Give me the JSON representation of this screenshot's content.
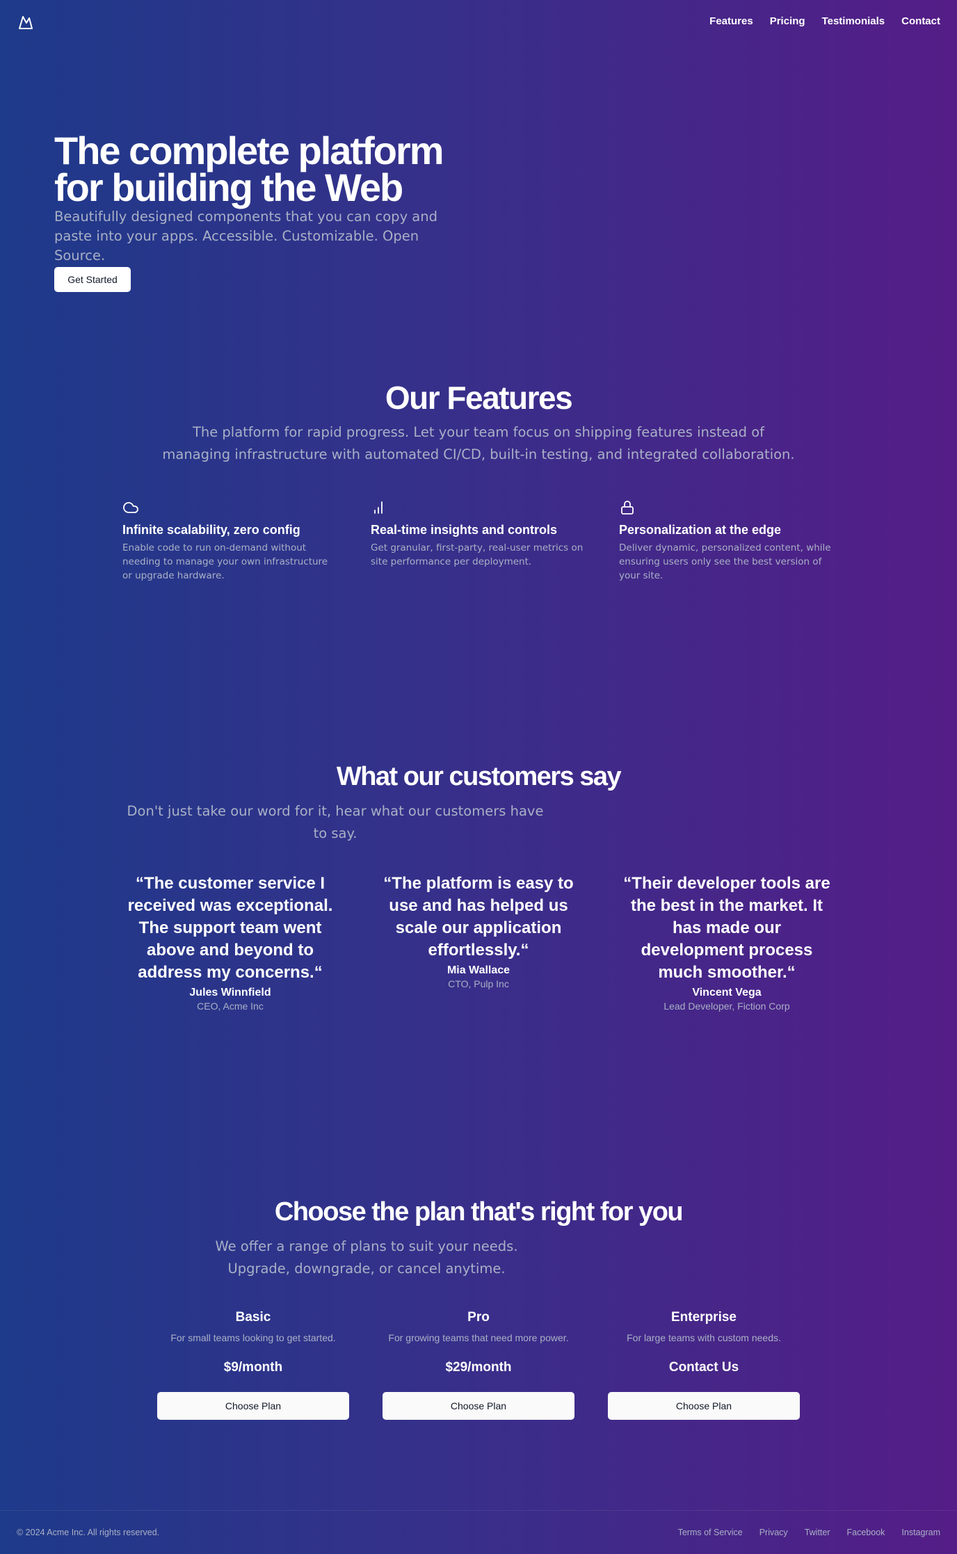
{
  "nav": {
    "logo_icon": "mountain-icon",
    "links": [
      "Features",
      "Pricing",
      "Testimonials",
      "Contact"
    ]
  },
  "hero": {
    "title_line1": "The complete platform",
    "title_line2": "for building the Web",
    "subtitle": "Beautifully designed components that you can copy and paste into your apps. Accessible. Customizable. Open Source.",
    "cta": "Get Started"
  },
  "features": {
    "title": "Our Features",
    "subtitle": "The platform for rapid progress. Let your team focus on shipping features instead of managing infrastructure with automated CI/CD, built-in testing, and integrated collaboration.",
    "items": [
      {
        "icon": "cloud-icon",
        "title": "Infinite scalability, zero config",
        "desc": "Enable code to run on-demand without needing to manage your own infrastructure or upgrade hardware."
      },
      {
        "icon": "bar-chart-icon",
        "title": "Real-time insights and controls",
        "desc": "Get granular, first-party, real-user metrics on site performance per deployment."
      },
      {
        "icon": "lock-icon",
        "title": "Personalization at the edge",
        "desc": "Deliver dynamic, personalized content, while ensuring users only see the best version of your site."
      }
    ]
  },
  "testimonials": {
    "title": "What our customers say",
    "subtitle": "Don't just take our word for it, hear what our customers have to say.",
    "items": [
      {
        "quote": "“The customer service I received was exceptional. The support team went above and beyond to address my concerns.“",
        "author": "Jules Winnfield",
        "role": "CEO, Acme Inc"
      },
      {
        "quote": "“The platform is easy to use and has helped us scale our application effortlessly.“",
        "author": "Mia Wallace",
        "role": "CTO, Pulp Inc"
      },
      {
        "quote": "“Their developer tools are the best in the market. It has made our development process much smoother.“",
        "author": "Vincent Vega",
        "role": "Lead Developer, Fiction Corp"
      }
    ]
  },
  "pricing": {
    "title": "Choose the plan that's right for you",
    "subtitle": "We offer a range of plans to suit your needs. Upgrade, downgrade, or cancel anytime.",
    "plans": [
      {
        "name": "Basic",
        "desc": "For small teams looking to get started.",
        "price": "$9/month",
        "cta": "Choose Plan"
      },
      {
        "name": "Pro",
        "desc": "For growing teams that need more power.",
        "price": "$29/month",
        "cta": "Choose Plan"
      },
      {
        "name": "Enterprise",
        "desc": "For large teams with custom needs.",
        "price": "Contact Us",
        "cta": "Choose Plan"
      }
    ]
  },
  "footer": {
    "copyright": "© 2024 Acme Inc. All rights reserved.",
    "links": [
      "Terms of Service",
      "Privacy",
      "Twitter",
      "Facebook",
      "Instagram"
    ]
  }
}
